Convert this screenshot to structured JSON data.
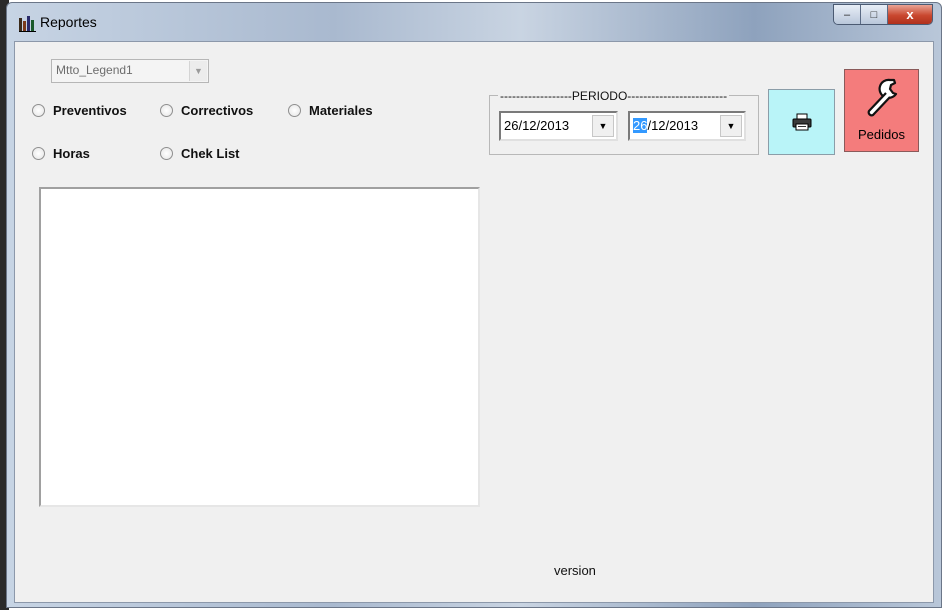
{
  "window": {
    "title": "Reportes"
  },
  "controls": {
    "minimize": "‒",
    "maximize": "□",
    "close": "x"
  },
  "combo": {
    "value": "Mtto_Legend1"
  },
  "radios": [
    {
      "label": "Preventivos",
      "checked": false
    },
    {
      "label": "Correctivos",
      "checked": false
    },
    {
      "label": "Materiales",
      "checked": false
    },
    {
      "label": "Horas",
      "checked": false
    },
    {
      "label": "Chek List",
      "checked": false
    }
  ],
  "periodo": {
    "title": "------------------PERIODO-------------------------",
    "from_date": "26/12/2013",
    "to_date_selected": "26",
    "to_date_rest": "/12/2013"
  },
  "buttons": {
    "pedidos_label": "Pedidos"
  },
  "icons": {
    "print": "printer-icon",
    "pedidos": "wrench-icon",
    "app": "bar-chart-icon"
  },
  "colors": {
    "print_button": "#b9f4f8",
    "pedidos_button": "#f47c7c",
    "selection": "#3399ff"
  },
  "footer": {
    "version": "version"
  }
}
